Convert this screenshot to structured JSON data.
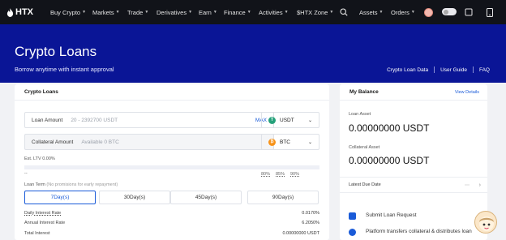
{
  "nav": {
    "brand": "HTX",
    "items": [
      {
        "label": "Buy Crypto",
        "caret": true
      },
      {
        "label": "Markets",
        "caret": true
      },
      {
        "label": "Trade",
        "caret": true
      },
      {
        "label": "Derivatives",
        "caret": true
      },
      {
        "label": "Earn",
        "caret": true
      },
      {
        "label": "Finance",
        "caret": true
      },
      {
        "label": "Activities",
        "caret": true
      },
      {
        "label": "$HTX Zone",
        "caret": true
      },
      {
        "label": "Assets",
        "caret": true
      },
      {
        "label": "Orders",
        "caret": true
      }
    ],
    "icons": [
      "search-icon",
      "avatar-icon",
      "theme-toggle-icon",
      "download-icon"
    ]
  },
  "hero": {
    "title": "Crypto Loans",
    "subtitle": "Borrow anytime with instant approval",
    "links": [
      "Crypto Loan Data",
      "User Guide",
      "FAQ"
    ],
    "background": "#0a1596"
  },
  "loan_form": {
    "header": "Crypto Loans",
    "loan_amount": {
      "label": "Loan Amount",
      "placeholder": "20 - 2392700 USDT",
      "max_label": "MAX",
      "coin": "USDT"
    },
    "collateral_amount": {
      "label": "Collateral Amount",
      "placeholder": "Available 0 BTC",
      "coin": "BTC"
    },
    "ltv_label": "Est. LTV 0.00%",
    "ltv_dash": "--",
    "ltv_marks": [
      "80%",
      "85%",
      "90%"
    ],
    "loan_term_label": "Loan Term",
    "loan_term_note": "(No promisions for early repayment)",
    "terms": [
      "7Day(s)",
      "30Day(s)",
      "45Day(s)",
      "90Day(s)"
    ],
    "selected_term": "7Day(s)",
    "rows": [
      {
        "label": "Daily Interest Rate",
        "value": "0.0170%"
      },
      {
        "label": "Annual Interest Rate",
        "value": "6.2050%"
      },
      {
        "label": "Total Interest",
        "value": "0.00000000 USDT"
      }
    ]
  },
  "balance": {
    "header": "My Balance",
    "view_details": "View Details",
    "loan_asset_label": "Loan Asset",
    "loan_asset_value": "0.00000000 USDT",
    "collateral_asset_label": "Collateral Asset",
    "collateral_asset_value": "0.00000000 USDT",
    "due_label": "Latest Due Date",
    "steps": [
      "Submit Loan Request",
      "Platform transfers collateral & distributes loan"
    ]
  },
  "colors": {
    "accent": "#1a5bd8",
    "usdt": "#26a17b",
    "btc": "#f7931a"
  }
}
